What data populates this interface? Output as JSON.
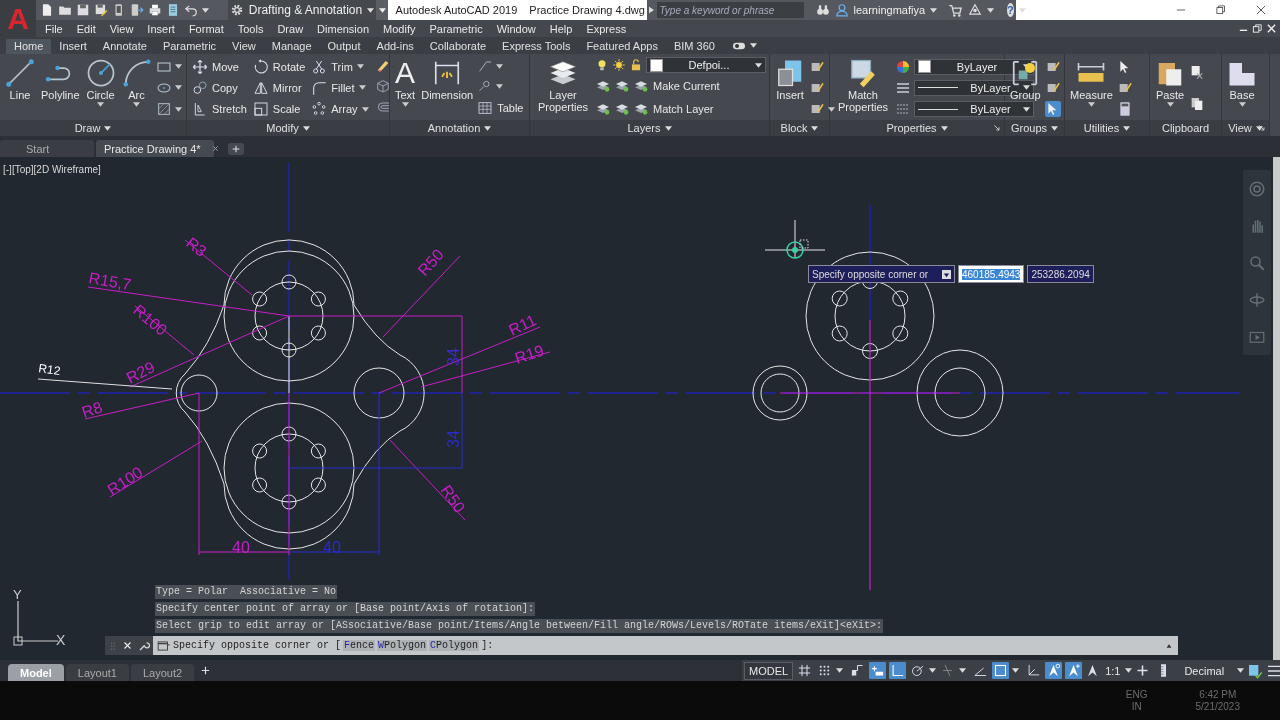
{
  "app_button": {
    "label": "A"
  },
  "quick_access": {
    "workspace": "Drafting & Annotation"
  },
  "window": {
    "app": "Autodesk AutoCAD 2019",
    "document": "Practice Drawing 4.dwg"
  },
  "search": {
    "placeholder": "Type a keyword or phrase"
  },
  "user": {
    "name": "learningmafiya",
    "help_glyph": "?"
  },
  "menu_bar": [
    "File",
    "Edit",
    "View",
    "Insert",
    "Format",
    "Tools",
    "Draw",
    "Dimension",
    "Modify",
    "Parametric",
    "Window",
    "Help",
    "Express"
  ],
  "ribbon_tabs": [
    {
      "label": "Home",
      "selected": true
    },
    {
      "label": "Insert",
      "selected": false
    },
    {
      "label": "Annotate",
      "selected": false
    },
    {
      "label": "Parametric",
      "selected": false
    },
    {
      "label": "View",
      "selected": false
    },
    {
      "label": "Manage",
      "selected": false
    },
    {
      "label": "Output",
      "selected": false
    },
    {
      "label": "Add-ins",
      "selected": false
    },
    {
      "label": "Collaborate",
      "selected": false
    },
    {
      "label": "Express Tools",
      "selected": false
    },
    {
      "label": "Featured Apps",
      "selected": false
    },
    {
      "label": "BIM 360",
      "selected": false
    }
  ],
  "ribbon_panels": [
    {
      "kind": "draw",
      "title": "Draw",
      "has_menu": true,
      "launcher": false,
      "tools": [
        {
          "label": "Line",
          "dropdown": false
        },
        {
          "label": "Polyline",
          "dropdown": false
        },
        {
          "label": "Circle",
          "dropdown": true
        },
        {
          "label": "Arc",
          "dropdown": true
        }
      ]
    },
    {
      "kind": "modify",
      "title": "Modify",
      "has_menu": true,
      "launcher": false,
      "tools": [
        {
          "label": "Move",
          "dropdown": false
        },
        {
          "label": "Rotate",
          "dropdown": false
        },
        {
          "label": "Trim",
          "dropdown": true
        },
        {
          "label": "Copy",
          "dropdown": false
        },
        {
          "label": "Mirror",
          "dropdown": false
        },
        {
          "label": "Fillet",
          "dropdown": true
        },
        {
          "label": "Stretch",
          "dropdown": false
        },
        {
          "label": "Scale",
          "dropdown": false
        },
        {
          "label": "Array",
          "dropdown": true
        }
      ]
    },
    {
      "kind": "annotation",
      "title": "Annotation",
      "has_menu": true,
      "launcher": false,
      "tools": [
        {
          "label": "Text",
          "glyph": "A",
          "dropdown": true
        },
        {
          "label": "Dimension",
          "dropdown": false
        },
        {
          "label": "Table",
          "dropdown": false
        }
      ]
    },
    {
      "kind": "layers",
      "title": "Layers",
      "has_menu": true,
      "launcher": false,
      "layer": "Defpoi...",
      "tools": [
        {
          "label": "Layer Properties",
          "dropdown": false
        },
        {
          "label": "Make Current",
          "dropdown": false
        },
        {
          "label": "Match Layer",
          "dropdown": false
        }
      ]
    },
    {
      "kind": "block",
      "title": "Block",
      "has_menu": true,
      "launcher": false,
      "tools": [
        {
          "label": "Insert",
          "dropdown": false
        }
      ]
    },
    {
      "kind": "properties",
      "title": "Properties",
      "has_menu": true,
      "launcher": true,
      "color_setting": "ByLayer",
      "linetype": "ByLayer",
      "lineweight": "ByLayer",
      "tools": [
        {
          "label": "Match Properties",
          "dropdown": false
        }
      ]
    },
    {
      "kind": "groups",
      "title": "Groups",
      "has_menu": true,
      "launcher": false,
      "group_selection": true,
      "tools": [
        {
          "label": "Group",
          "dropdown": false
        }
      ]
    },
    {
      "kind": "utilities",
      "title": "Utilities",
      "has_menu": true,
      "launcher": false,
      "tools": [
        {
          "label": "Measure",
          "dropdown": true
        }
      ]
    },
    {
      "kind": "clipboard",
      "title": "Clipboard",
      "has_menu": false,
      "launcher": false,
      "tools": [
        {
          "label": "Paste",
          "dropdown": true
        }
      ]
    },
    {
      "kind": "view",
      "title": "View",
      "has_menu": true,
      "launcher": true,
      "tools": [
        {
          "label": "Base",
          "dropdown": true
        }
      ]
    }
  ],
  "file_tabs": [
    {
      "label": "Start",
      "selected": false,
      "closable": false
    },
    {
      "label": "Practice Drawing 4*",
      "selected": true,
      "closable": true
    }
  ],
  "viewport_controls": [
    "[-]",
    "[Top]",
    "[2D Wireframe]"
  ],
  "drawing": {
    "dimension_labels": [
      {
        "text": "R3",
        "color": "#c81ec8"
      },
      {
        "text": "R15,7",
        "color": "#c81ec8"
      },
      {
        "text": "R100",
        "color": "#c81ec8"
      },
      {
        "text": "R29",
        "color": "#c81ec8"
      },
      {
        "text": "R12",
        "color": "#ffffff"
      },
      {
        "text": "R8",
        "color": "#c81ec8"
      },
      {
        "text": "R100",
        "color": "#c81ec8"
      },
      {
        "text": "R50",
        "color": "#c81ec8"
      },
      {
        "text": "R11",
        "color": "#c81ec8"
      },
      {
        "text": "R19",
        "color": "#c81ec8"
      },
      {
        "text": "34",
        "color": "#3a2ad0"
      },
      {
        "text": "34",
        "color": "#2a2ad0"
      },
      {
        "text": "R50",
        "color": "#c81ec8"
      },
      {
        "text": "40",
        "color": "#c81ec8"
      },
      {
        "text": "40",
        "color": "#2a2ad0"
      }
    ]
  },
  "dynamic_input": {
    "prompt": "Specify opposite corner or",
    "fields": [
      {
        "value": "460185.4943",
        "selected": true
      },
      {
        "value": "253286.2094",
        "selected": false
      }
    ]
  },
  "ucs": {
    "x_axis": "X",
    "y_axis": "Y"
  },
  "command_history": [
    "Type = Polar  Associative = No",
    "Specify center point of array or [Base point/Axis of rotation]:",
    "Select grip to edit array or [ASsociative/Base point/Items/Angle between/Fill angle/ROWs/Levels/ROTate items/eXit]<eXit>:"
  ],
  "command_line": {
    "prompt": "Specify opposite corner or [",
    "options": [
      {
        "key": "F",
        "rest": "ence"
      },
      {
        "key": "W",
        "rest": "Polygon"
      },
      {
        "key": "C",
        "rest": "Polygon"
      }
    ],
    "end": "]:"
  },
  "layout_tabs": [
    {
      "label": "Model",
      "selected": true
    },
    {
      "label": "Layout1",
      "selected": false
    },
    {
      "label": "Layout2",
      "selected": false
    }
  ],
  "status_bar": {
    "space": "MODEL",
    "toggles": [
      {
        "on": false
      },
      {
        "on": false
      },
      {
        "on": false
      },
      {
        "on": true
      },
      {
        "on": true
      },
      {
        "on": false
      },
      {
        "on": false
      },
      {
        "on": false
      },
      {
        "on": true
      },
      {
        "on": false
      },
      {
        "on": true
      },
      {
        "on": true
      }
    ],
    "annotation_scale": "1:1",
    "units": "Decimal"
  },
  "taskbar": {
    "language": "ENG",
    "region": "IN",
    "time": "6:42 PM",
    "date": "5/21/2023"
  }
}
